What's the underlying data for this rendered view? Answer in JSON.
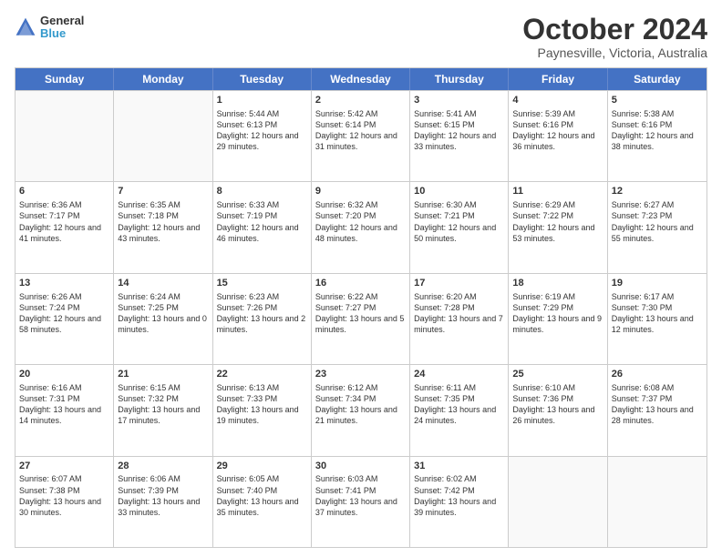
{
  "header": {
    "logo": {
      "general": "General",
      "blue": "Blue"
    },
    "title": "October 2024",
    "location": "Paynesville, Victoria, Australia"
  },
  "days": [
    "Sunday",
    "Monday",
    "Tuesday",
    "Wednesday",
    "Thursday",
    "Friday",
    "Saturday"
  ],
  "weeks": [
    [
      {
        "day": "",
        "info": ""
      },
      {
        "day": "",
        "info": ""
      },
      {
        "day": "1",
        "info": "Sunrise: 5:44 AM\nSunset: 6:13 PM\nDaylight: 12 hours and 29 minutes."
      },
      {
        "day": "2",
        "info": "Sunrise: 5:42 AM\nSunset: 6:14 PM\nDaylight: 12 hours and 31 minutes."
      },
      {
        "day": "3",
        "info": "Sunrise: 5:41 AM\nSunset: 6:15 PM\nDaylight: 12 hours and 33 minutes."
      },
      {
        "day": "4",
        "info": "Sunrise: 5:39 AM\nSunset: 6:16 PM\nDaylight: 12 hours and 36 minutes."
      },
      {
        "day": "5",
        "info": "Sunrise: 5:38 AM\nSunset: 6:16 PM\nDaylight: 12 hours and 38 minutes."
      }
    ],
    [
      {
        "day": "6",
        "info": "Sunrise: 6:36 AM\nSunset: 7:17 PM\nDaylight: 12 hours and 41 minutes."
      },
      {
        "day": "7",
        "info": "Sunrise: 6:35 AM\nSunset: 7:18 PM\nDaylight: 12 hours and 43 minutes."
      },
      {
        "day": "8",
        "info": "Sunrise: 6:33 AM\nSunset: 7:19 PM\nDaylight: 12 hours and 46 minutes."
      },
      {
        "day": "9",
        "info": "Sunrise: 6:32 AM\nSunset: 7:20 PM\nDaylight: 12 hours and 48 minutes."
      },
      {
        "day": "10",
        "info": "Sunrise: 6:30 AM\nSunset: 7:21 PM\nDaylight: 12 hours and 50 minutes."
      },
      {
        "day": "11",
        "info": "Sunrise: 6:29 AM\nSunset: 7:22 PM\nDaylight: 12 hours and 53 minutes."
      },
      {
        "day": "12",
        "info": "Sunrise: 6:27 AM\nSunset: 7:23 PM\nDaylight: 12 hours and 55 minutes."
      }
    ],
    [
      {
        "day": "13",
        "info": "Sunrise: 6:26 AM\nSunset: 7:24 PM\nDaylight: 12 hours and 58 minutes."
      },
      {
        "day": "14",
        "info": "Sunrise: 6:24 AM\nSunset: 7:25 PM\nDaylight: 13 hours and 0 minutes."
      },
      {
        "day": "15",
        "info": "Sunrise: 6:23 AM\nSunset: 7:26 PM\nDaylight: 13 hours and 2 minutes."
      },
      {
        "day": "16",
        "info": "Sunrise: 6:22 AM\nSunset: 7:27 PM\nDaylight: 13 hours and 5 minutes."
      },
      {
        "day": "17",
        "info": "Sunrise: 6:20 AM\nSunset: 7:28 PM\nDaylight: 13 hours and 7 minutes."
      },
      {
        "day": "18",
        "info": "Sunrise: 6:19 AM\nSunset: 7:29 PM\nDaylight: 13 hours and 9 minutes."
      },
      {
        "day": "19",
        "info": "Sunrise: 6:17 AM\nSunset: 7:30 PM\nDaylight: 13 hours and 12 minutes."
      }
    ],
    [
      {
        "day": "20",
        "info": "Sunrise: 6:16 AM\nSunset: 7:31 PM\nDaylight: 13 hours and 14 minutes."
      },
      {
        "day": "21",
        "info": "Sunrise: 6:15 AM\nSunset: 7:32 PM\nDaylight: 13 hours and 17 minutes."
      },
      {
        "day": "22",
        "info": "Sunrise: 6:13 AM\nSunset: 7:33 PM\nDaylight: 13 hours and 19 minutes."
      },
      {
        "day": "23",
        "info": "Sunrise: 6:12 AM\nSunset: 7:34 PM\nDaylight: 13 hours and 21 minutes."
      },
      {
        "day": "24",
        "info": "Sunrise: 6:11 AM\nSunset: 7:35 PM\nDaylight: 13 hours and 24 minutes."
      },
      {
        "day": "25",
        "info": "Sunrise: 6:10 AM\nSunset: 7:36 PM\nDaylight: 13 hours and 26 minutes."
      },
      {
        "day": "26",
        "info": "Sunrise: 6:08 AM\nSunset: 7:37 PM\nDaylight: 13 hours and 28 minutes."
      }
    ],
    [
      {
        "day": "27",
        "info": "Sunrise: 6:07 AM\nSunset: 7:38 PM\nDaylight: 13 hours and 30 minutes."
      },
      {
        "day": "28",
        "info": "Sunrise: 6:06 AM\nSunset: 7:39 PM\nDaylight: 13 hours and 33 minutes."
      },
      {
        "day": "29",
        "info": "Sunrise: 6:05 AM\nSunset: 7:40 PM\nDaylight: 13 hours and 35 minutes."
      },
      {
        "day": "30",
        "info": "Sunrise: 6:03 AM\nSunset: 7:41 PM\nDaylight: 13 hours and 37 minutes."
      },
      {
        "day": "31",
        "info": "Sunrise: 6:02 AM\nSunset: 7:42 PM\nDaylight: 13 hours and 39 minutes."
      },
      {
        "day": "",
        "info": ""
      },
      {
        "day": "",
        "info": ""
      }
    ]
  ]
}
